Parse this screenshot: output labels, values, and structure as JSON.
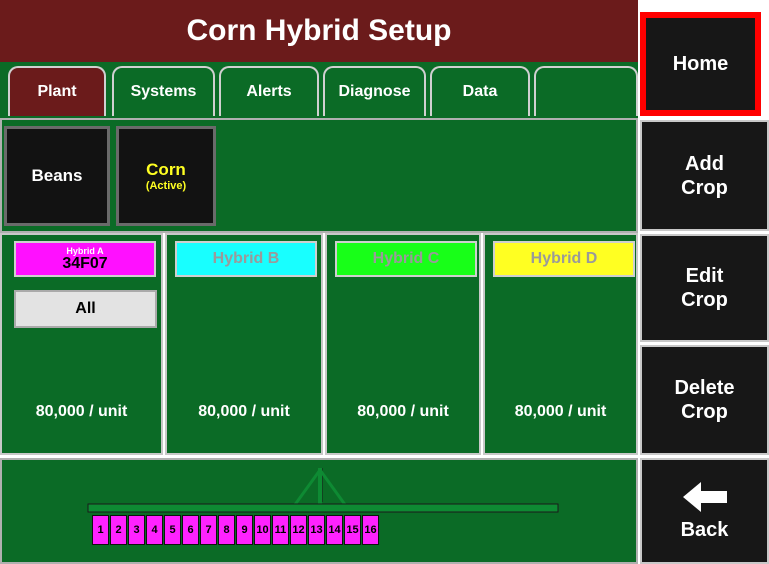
{
  "header": {
    "title": "Corn Hybrid Setup"
  },
  "tabs": [
    {
      "label": "Plant",
      "active": true
    },
    {
      "label": "Systems",
      "active": false
    },
    {
      "label": "Alerts",
      "active": false
    },
    {
      "label": "Diagnose",
      "active": false
    },
    {
      "label": "Data",
      "active": false
    },
    {
      "label": "",
      "active": false
    }
  ],
  "side_buttons": {
    "home": "Home",
    "add_crop": [
      "Add",
      "Crop"
    ],
    "edit_crop": [
      "Edit",
      "Crop"
    ],
    "delete_crop": [
      "Delete",
      "Crop"
    ],
    "back": "Back"
  },
  "crops": [
    {
      "name": "Beans",
      "status": ""
    },
    {
      "name": "Corn",
      "status": "(Active)"
    }
  ],
  "hybrids": [
    {
      "slot": "Hybrid A",
      "name": "34F07",
      "rows": "All",
      "rate": "80,000 / unit",
      "color": "#ff10ff"
    },
    {
      "slot": "Hybrid B",
      "name": "",
      "rows": "",
      "rate": "80,000 / unit",
      "color": "#18ffff"
    },
    {
      "slot": "Hybrid C",
      "name": "",
      "rows": "",
      "rate": "80,000 / unit",
      "color": "#18ff18"
    },
    {
      "slot": "Hybrid D",
      "name": "",
      "rows": "",
      "rate": "80,000 / unit",
      "color": "#ffff22"
    }
  ],
  "planter": {
    "rows": [
      "1",
      "2",
      "3",
      "4",
      "5",
      "6",
      "7",
      "8",
      "9",
      "10",
      "11",
      "12",
      "13",
      "14",
      "15",
      "16"
    ],
    "row_color": "#ff22ff"
  },
  "colors": {
    "title_bar": "#6b1b1b",
    "panel_green": "#0b6b26",
    "button_dark": "#171717",
    "highlight_border": "#ff0000"
  }
}
